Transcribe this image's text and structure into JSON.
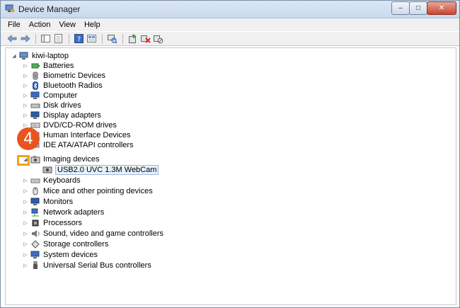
{
  "window": {
    "title": "Device Manager",
    "caption_min": "–",
    "caption_max": "□",
    "caption_close": "✕"
  },
  "menu": [
    "File",
    "Action",
    "View",
    "Help"
  ],
  "toolbar": {
    "icons": [
      "back-arrow-icon",
      "forward-arrow-icon",
      "show-hide-tree-icon",
      "properties-icon",
      "help-icon",
      "details-icon",
      "scan-hardware-icon",
      "update-driver-icon",
      "uninstall-icon",
      "disable-icon"
    ]
  },
  "tree": {
    "root": {
      "label": "kiwi-laptop",
      "expander": "◢"
    },
    "items": [
      {
        "label": "Batteries",
        "icon": "battery-icon",
        "expander": "▷"
      },
      {
        "label": "Biometric Devices",
        "icon": "biometric-icon",
        "expander": "▷"
      },
      {
        "label": "Bluetooth Radios",
        "icon": "bluetooth-icon",
        "expander": "▷"
      },
      {
        "label": "Computer",
        "icon": "computer-icon",
        "expander": "▷"
      },
      {
        "label": "Disk drives",
        "icon": "disk-drive-icon",
        "expander": "▷"
      },
      {
        "label": "Display adapters",
        "icon": "display-adapter-icon",
        "expander": "▷"
      },
      {
        "label": "DVD/CD-ROM drives",
        "icon": "dvd-drive-icon",
        "expander": "▷"
      },
      {
        "label": "Human Interface Devices",
        "icon": "hid-icon",
        "expander": "▷"
      },
      {
        "label": "IDE ATA/ATAPI controllers",
        "icon": "ide-controller-icon",
        "expander": "▷"
      },
      {
        "label": "Imaging devices",
        "icon": "camera-icon",
        "expander": "◢"
      },
      {
        "label": "USB2.0 UVC 1.3M WebCam",
        "icon": "webcam-icon",
        "child": true
      },
      {
        "label": "Keyboards",
        "icon": "keyboard-icon",
        "expander": "▷"
      },
      {
        "label": "Mice and other pointing devices",
        "icon": "mouse-icon",
        "expander": "▷"
      },
      {
        "label": "Monitors",
        "icon": "monitor-icon",
        "expander": "▷"
      },
      {
        "label": "Network adapters",
        "icon": "network-adapter-icon",
        "expander": "▷"
      },
      {
        "label": "Processors",
        "icon": "processor-icon",
        "expander": "▷"
      },
      {
        "label": "Sound, video and game controllers",
        "icon": "sound-icon",
        "expander": "▷"
      },
      {
        "label": "Storage controllers",
        "icon": "storage-controller-icon",
        "expander": "▷"
      },
      {
        "label": "System devices",
        "icon": "system-device-icon",
        "expander": "▷"
      },
      {
        "label": "Universal Serial Bus controllers",
        "icon": "usb-icon",
        "expander": "▷"
      }
    ]
  },
  "annotation": {
    "step_number": "4"
  },
  "colors": {
    "badge": "#e8541d",
    "highlight": "#f2a21a",
    "selection_bg": "#e8f0fb"
  }
}
